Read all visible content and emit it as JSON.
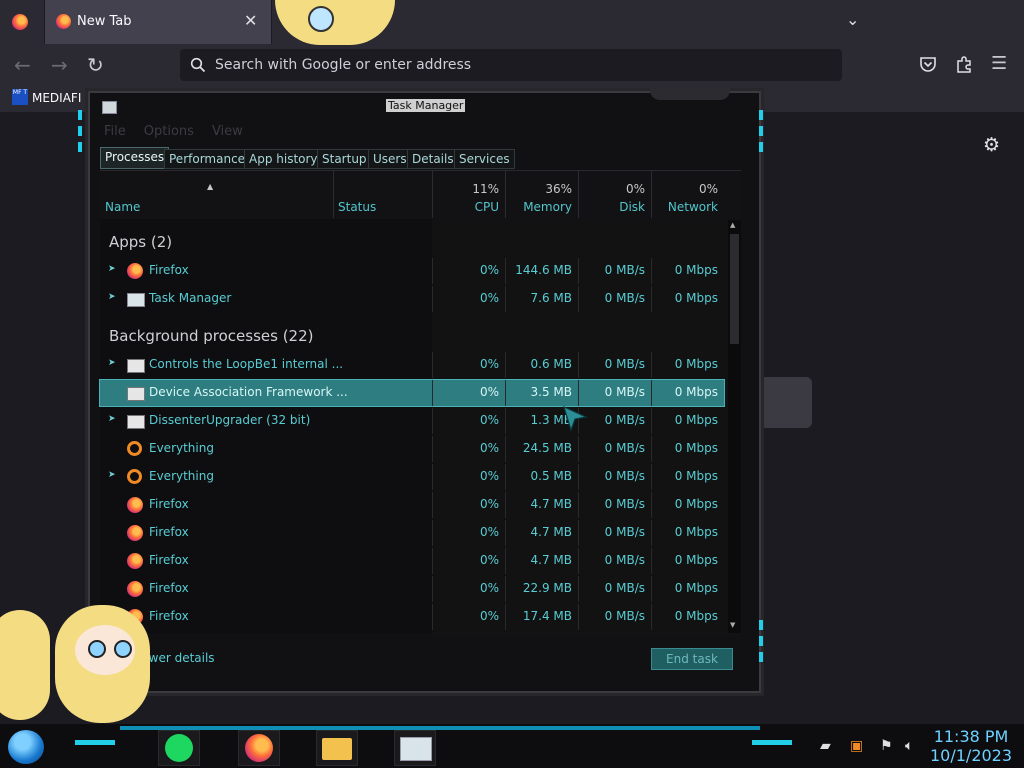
{
  "browser": {
    "tab_title": "New Tab",
    "url_placeholder": "Search with Google or enter address",
    "bookmark_label": "MEDIAFI",
    "bookmark_favicon_text": "MF T"
  },
  "task_manager": {
    "window_title": "Task Manager",
    "menu": [
      "File",
      "Options",
      "View"
    ],
    "tabs": [
      "Processes",
      "Performance",
      "App history",
      "Startup",
      "Users",
      "Details",
      "Services"
    ],
    "active_tab": "Processes",
    "columns": {
      "name": "Name",
      "status": "Status",
      "cpu": {
        "label": "CPU",
        "percent": "11%"
      },
      "memory": {
        "label": "Memory",
        "percent": "36%"
      },
      "disk": {
        "label": "Disk",
        "percent": "0%"
      },
      "network": {
        "label": "Network",
        "percent": "0%"
      }
    },
    "groups": {
      "apps": "Apps (2)",
      "background": "Background processes (22)"
    },
    "apps": [
      {
        "name": "Firefox",
        "cpu": "0%",
        "memory": "144.6 MB",
        "disk": "0 MB/s",
        "network": "0 Mbps",
        "icon": "firefox-icon",
        "expandable": true
      },
      {
        "name": "Task Manager",
        "cpu": "0%",
        "memory": "7.6 MB",
        "disk": "0 MB/s",
        "network": "0 Mbps",
        "icon": "task-manager-icon",
        "expandable": true
      }
    ],
    "background": [
      {
        "name": "Controls the LoopBe1 internal ...",
        "cpu": "0%",
        "memory": "0.6 MB",
        "disk": "0 MB/s",
        "network": "0 Mbps",
        "icon": "app-window-icon",
        "expandable": true
      },
      {
        "name": "Device Association Framework ...",
        "cpu": "0%",
        "memory": "3.5 MB",
        "disk": "0 MB/s",
        "network": "0 Mbps",
        "icon": "app-window-icon",
        "expandable": false,
        "selected": true
      },
      {
        "name": "DissenterUpgrader (32 bit)",
        "cpu": "0%",
        "memory": "1.3 MB",
        "disk": "0 MB/s",
        "network": "0 Mbps",
        "icon": "app-window-icon",
        "expandable": true
      },
      {
        "name": "Everything",
        "cpu": "0%",
        "memory": "24.5 MB",
        "disk": "0 MB/s",
        "network": "0 Mbps",
        "icon": "magnifier-icon",
        "expandable": false
      },
      {
        "name": "Everything",
        "cpu": "0%",
        "memory": "0.5 MB",
        "disk": "0 MB/s",
        "network": "0 Mbps",
        "icon": "magnifier-icon",
        "expandable": true
      },
      {
        "name": "Firefox",
        "cpu": "0%",
        "memory": "4.7 MB",
        "disk": "0 MB/s",
        "network": "0 Mbps",
        "icon": "firefox-icon",
        "expandable": false
      },
      {
        "name": "Firefox",
        "cpu": "0%",
        "memory": "4.7 MB",
        "disk": "0 MB/s",
        "network": "0 Mbps",
        "icon": "firefox-icon",
        "expandable": false
      },
      {
        "name": "Firefox",
        "cpu": "0%",
        "memory": "4.7 MB",
        "disk": "0 MB/s",
        "network": "0 Mbps",
        "icon": "firefox-icon",
        "expandable": false
      },
      {
        "name": "Firefox",
        "cpu": "0%",
        "memory": "22.9 MB",
        "disk": "0 MB/s",
        "network": "0 Mbps",
        "icon": "firefox-icon",
        "expandable": false
      },
      {
        "name": "Firefox",
        "cpu": "0%",
        "memory": "17.4 MB",
        "disk": "0 MB/s",
        "network": "0 Mbps",
        "icon": "firefox-icon",
        "expandable": false
      }
    ],
    "fewer_details": "Fewer details",
    "end_task": "End task"
  },
  "taskbar": {
    "time": "11:38 PM",
    "date": "10/1/2023"
  },
  "colors": {
    "accent_cyan": "#58cdd3",
    "selection": "#2e7d80",
    "browser_bg": "#2b2a33"
  }
}
